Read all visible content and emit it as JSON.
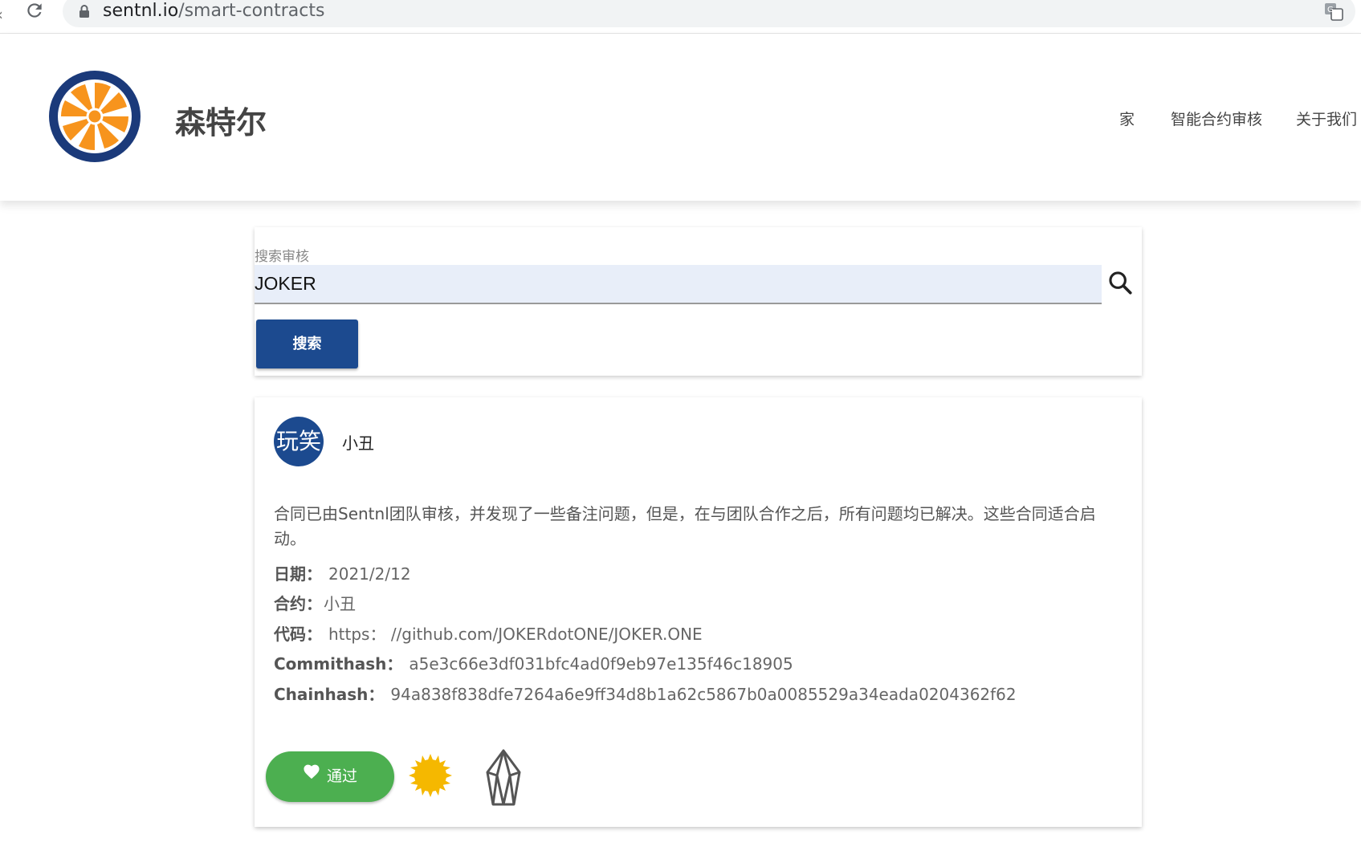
{
  "browser": {
    "url_host": "sentnl.io",
    "url_path": "/smart-contracts"
  },
  "header": {
    "brand": "森特尔",
    "nav": [
      {
        "label": "家"
      },
      {
        "label": "智能合约审核"
      },
      {
        "label": "关于我们"
      }
    ]
  },
  "search": {
    "label": "搜索审核",
    "value": "JOKER",
    "button_label": "搜索"
  },
  "result": {
    "avatar_text": "玩笑",
    "name": "小丑",
    "description": "合同已由Sentnl团队审核，并发现了一些备注问题，但是，在与团队合作之后，所有问题均已解决。这些合同适合启动。",
    "fields": {
      "date_label": "日期：",
      "date_value": "2021/2/12",
      "contract_label": "合约：",
      "contract_value": "小丑",
      "code_label": "代码：",
      "code_value": "https：  //github.com/JOKERdotONE/JOKER.ONE",
      "commit_label": "Commithash：",
      "commit_value": "a5e3c66e3df031bfc4ad0f9eb97e135f46c18905",
      "chain_label": "Chainhash：",
      "chain_value": "94a838f838dfe7264a6e9ff34d8b1a62c5867b0a0085529a34eada0204362f62"
    },
    "pass_label": "通过"
  },
  "colors": {
    "primary": "#1c4a8f",
    "success": "#4caf50",
    "logo_orange": "#f7941d",
    "sun_yellow": "#f5b800"
  }
}
